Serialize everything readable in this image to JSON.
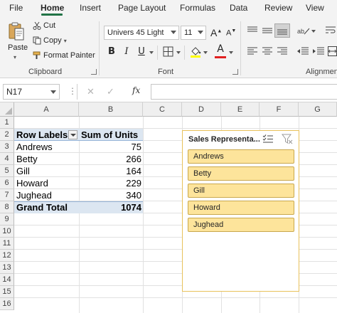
{
  "ribbon": {
    "tabs": [
      "File",
      "Home",
      "Insert",
      "Page Layout",
      "Formulas",
      "Data",
      "Review",
      "View"
    ],
    "active_tab": "Home",
    "clipboard": {
      "paste_label": "Paste",
      "cut_label": "Cut",
      "copy_label": "Copy",
      "format_painter_label": "Format Painter",
      "group_label": "Clipboard"
    },
    "font": {
      "font_name": "Univers 45 Light",
      "font_size": "11",
      "bold": "B",
      "italic": "I",
      "underline": "U",
      "font_color_letter": "A",
      "grow_letter": "A",
      "shrink_letter": "A",
      "group_label": "Font"
    },
    "alignment": {
      "group_label": "Alignmen"
    }
  },
  "formula_bar": {
    "name_box": "N17",
    "fx": "fx",
    "formula": ""
  },
  "grid": {
    "columns": [
      "A",
      "B",
      "C",
      "D",
      "E",
      "F",
      "G"
    ],
    "rows": [
      "1",
      "2",
      "3",
      "4",
      "5",
      "6",
      "7",
      "8",
      "9",
      "10",
      "11",
      "12",
      "13",
      "14",
      "15",
      "16"
    ]
  },
  "pivot": {
    "header_labels": "Row Labels",
    "header_values": "Sum of Units",
    "rows": [
      {
        "label": "Andrews",
        "value": "75"
      },
      {
        "label": "Betty",
        "value": "266"
      },
      {
        "label": "Gill",
        "value": "164"
      },
      {
        "label": "Howard",
        "value": "229"
      },
      {
        "label": "Jughead",
        "value": "340"
      }
    ],
    "total_label": "Grand Total",
    "total_value": "1074"
  },
  "slicer": {
    "title": "Sales Representa...",
    "items": [
      "Andrews",
      "Betty",
      "Gill",
      "Howard",
      "Jughead"
    ]
  },
  "colors": {
    "accent": "#217346",
    "pivot_header": "#dce6f1",
    "slicer_item": "#fde49b",
    "slicer_border": "#e8c15a"
  }
}
